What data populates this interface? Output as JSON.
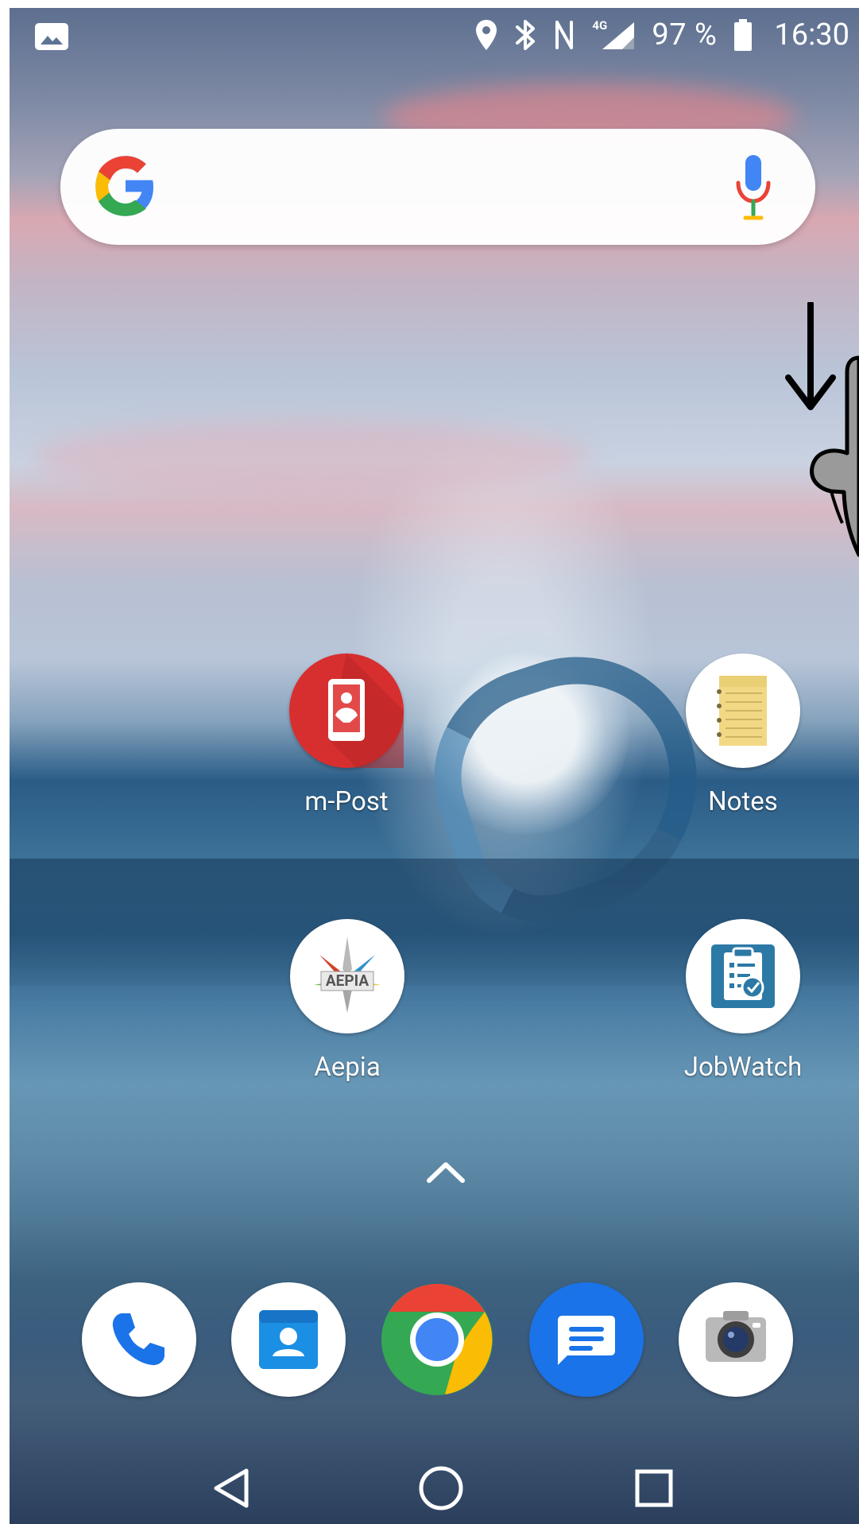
{
  "status_bar": {
    "battery_text": "97 %",
    "time": "16:30",
    "network": "4G"
  },
  "apps": {
    "m_post": {
      "label": "m-Post",
      "icon": "m-post-icon"
    },
    "notes": {
      "label": "Notes",
      "icon": "notes-icon"
    },
    "aepia": {
      "label": "Aepia",
      "icon": "aepia-icon",
      "logo_text": "AEPIA"
    },
    "jobwatch": {
      "label": "JobWatch",
      "icon": "jobwatch-icon"
    }
  },
  "dock": [
    {
      "name": "phone",
      "icon": "phone-icon"
    },
    {
      "name": "contacts",
      "icon": "contacts-icon"
    },
    {
      "name": "chrome",
      "icon": "chrome-icon"
    },
    {
      "name": "messages",
      "icon": "messages-icon"
    },
    {
      "name": "camera",
      "icon": "camera-icon"
    }
  ],
  "navigation": {
    "back": "back-icon",
    "home": "home-icon",
    "recents": "recents-icon"
  },
  "colors": {
    "google_blue": "#4285F4",
    "google_red": "#EA4335",
    "google_yellow": "#FBBC05",
    "google_green": "#34A853",
    "mpost_red": "#D72F2F",
    "jobwatch_blue": "#2C79A6",
    "messages_blue": "#1A73E8"
  }
}
